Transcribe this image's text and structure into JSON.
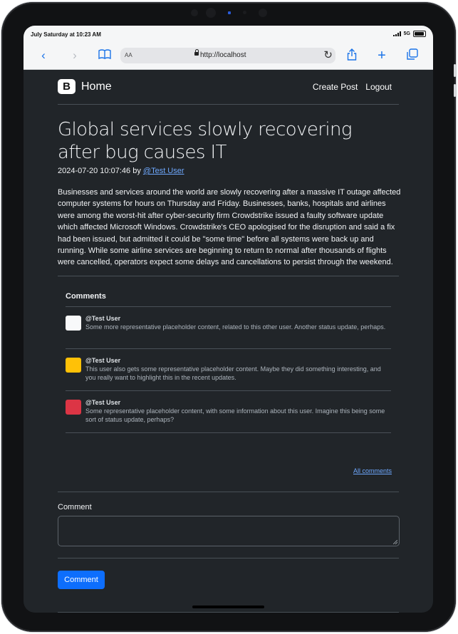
{
  "status_bar": {
    "time": "July Saturday at 10:23 AM",
    "network": "5G"
  },
  "browser": {
    "aa_label": "AA",
    "url": "http://localhost",
    "icons": [
      "back-icon",
      "forward-icon",
      "bookmarks-icon",
      "lock-icon",
      "reload-icon",
      "share-icon",
      "new-tab-icon",
      "tabs-icon"
    ]
  },
  "nav": {
    "logo_letter": "B",
    "brand": "Home",
    "links": [
      "Create Post",
      "Logout"
    ]
  },
  "post": {
    "title": "Global services slowly recovering after bug causes IT",
    "date": "2024-07-20 10:07:46",
    "by": "by",
    "author": "@Test User",
    "body": "Businesses and services around the world are slowly recovering after a massive IT outage affected computer systems for hours on Thursday and Friday. Businesses, banks, hospitals and airlines were among the worst-hit after cyber-security firm Crowdstrike issued a faulty software update which affected Microsoft Windows. Crowdstrike's CEO apologised for the disruption and said a fix had been issued, but admitted it could be \"some time\" before all systems were back up and running. While some airline services are beginning to return to normal after thousands of flights were cancelled, operators expect some delays and cancellations to persist through the weekend."
  },
  "comments": {
    "heading": "Comments",
    "items": [
      {
        "user": "@Test User",
        "text": "Some more representative placeholder content, related to this other user. Another status update, perhaps.",
        "avatar_color": "#f8f9fa"
      },
      {
        "user": "@Test User",
        "text": "This user also gets some representative placeholder content. Maybe they did something interesting, and you really want to highlight this in the recent updates.",
        "avatar_color": "#ffc107"
      },
      {
        "user": "@Test User",
        "text": "Some representative placeholder content, with some information about this user. Imagine this being some sort of status update, perhaps?",
        "avatar_color": "#dc3545"
      }
    ],
    "all_link": "All comments"
  },
  "form": {
    "label": "Comment",
    "value": "",
    "button": "Comment"
  },
  "colors": {
    "page_bg": "#212529",
    "accent": "#0d6efd",
    "link": "#6ea8fe"
  }
}
